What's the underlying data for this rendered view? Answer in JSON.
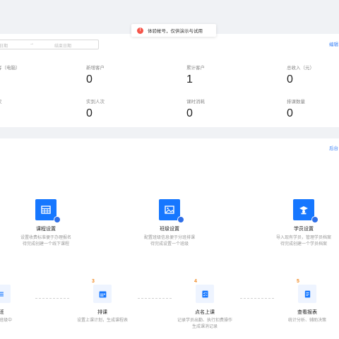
{
  "toast": {
    "icon": "info-icon",
    "text": "体验帐号，仅供演示与试用"
  },
  "stats": {
    "date_start_placeholder": "日期",
    "date_separator": "→",
    "date_end_placeholder": "结束日期",
    "edit_link": "编辑",
    "items": [
      {
        "label": "客（电脑）",
        "value": ""
      },
      {
        "label": "新增客户",
        "value": "0"
      },
      {
        "label": "累计客户",
        "value": "1"
      },
      {
        "label": "总收入（元）",
        "value": "0"
      },
      {
        "label": "次",
        "value": ""
      },
      {
        "label": "实到人次",
        "value": "0"
      },
      {
        "label": "课时消耗",
        "value": "0"
      },
      {
        "label": "排课数量",
        "value": "0"
      }
    ]
  },
  "guide": {
    "link": "后台",
    "features": [
      {
        "title": "课程设置",
        "desc1": "设置收费标准便于办理报名",
        "desc2": "待完成创建一个线下课程",
        "icon": "table-icon"
      },
      {
        "title": "班级设置",
        "desc1": "配置班级信息便于分班排课",
        "desc2": "待完成设置一个班级",
        "icon": "image-icon"
      },
      {
        "title": "学员设置",
        "desc1": "导入现有学员，管理学员档案",
        "desc2": "待完成创建一个学员档案",
        "icon": "graduate-icon"
      }
    ],
    "steps": [
      {
        "num": "",
        "title": "班",
        "desc1": "具体班级中",
        "desc2": "",
        "icon": "branch-icon"
      },
      {
        "num": "3",
        "title": "排课",
        "desc1": "设置上课计划，生成课程表",
        "desc2": "",
        "icon": "calendar-icon"
      },
      {
        "num": "4",
        "title": "点名上课",
        "desc1": "记录学员出勤、执行扣费操作",
        "desc2": "生成课消记录",
        "icon": "checklist-icon"
      },
      {
        "num": "5",
        "title": "查看报表",
        "desc1": "统计分析、辅助决策",
        "desc2": "",
        "icon": "report-icon"
      }
    ]
  },
  "colors": {
    "accent": "#1677ff",
    "step_number": "#f08a24",
    "link": "#3b82f6"
  }
}
